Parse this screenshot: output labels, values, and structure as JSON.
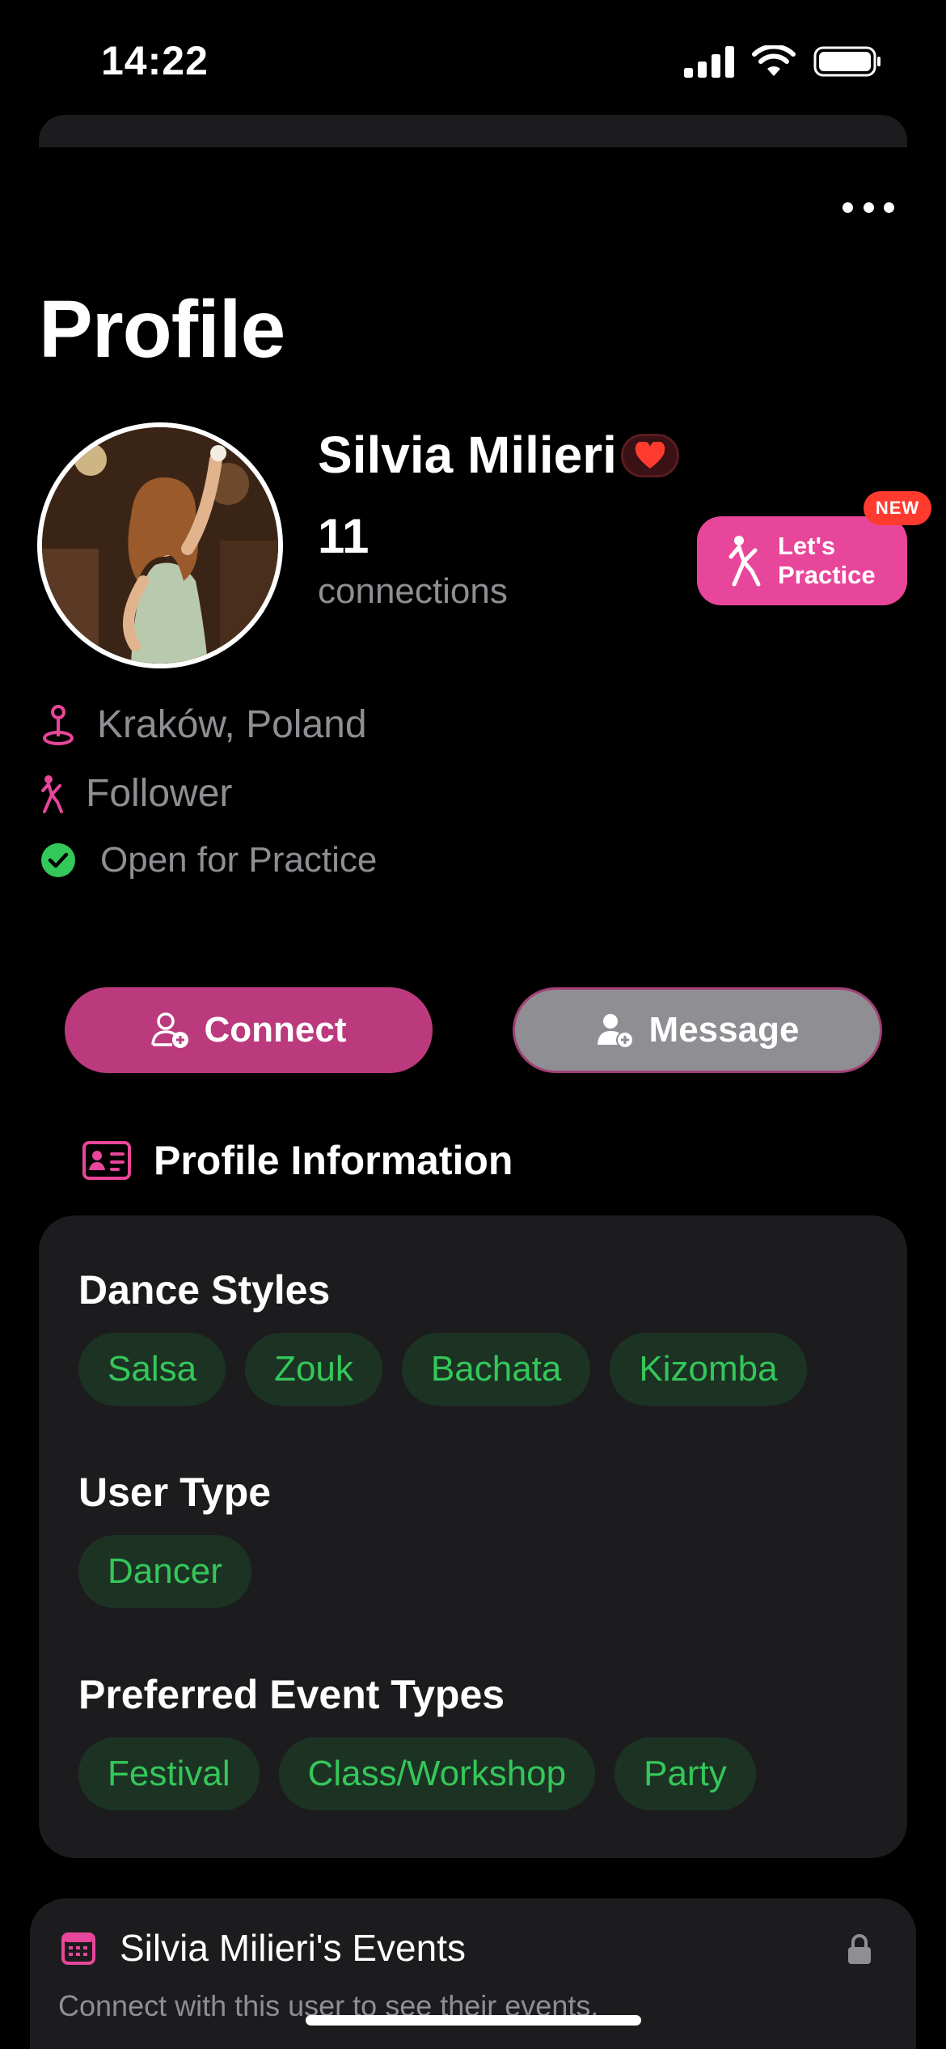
{
  "status_bar": {
    "time": "14:22",
    "icons": [
      "signal-icon",
      "wifi-icon",
      "battery-icon"
    ]
  },
  "header": {
    "title": "Profile",
    "more_icon": "more-horizontal-icon"
  },
  "profile": {
    "name": "Silvia Milieri",
    "connections_count": "11",
    "connections_label": "connections",
    "badge_icon": "heart-icon",
    "location": "Kraków, Poland",
    "role": "Follower",
    "availability": "Open for Practice"
  },
  "practice_button": {
    "label": "Let's\nPractice",
    "badge": "NEW"
  },
  "actions": {
    "connect_label": "Connect",
    "message_label": "Message"
  },
  "profile_information": {
    "title": "Profile Information",
    "groups": [
      {
        "label": "Dance Styles",
        "chips": [
          "Salsa",
          "Zouk",
          "Bachata",
          "Kizomba"
        ]
      },
      {
        "label": "User Type",
        "chips": [
          "Dancer"
        ]
      },
      {
        "label": "Preferred Event Types",
        "chips": [
          "Festival",
          "Class/Workshop",
          "Party"
        ]
      }
    ]
  },
  "events": {
    "title": "Silvia Milieri's Events",
    "subtitle": "Connect with this user to see their events."
  },
  "colors": {
    "accent_pink": "#e8469a",
    "connect_pink": "#bb3a7d",
    "chip_green": "#34c759",
    "chip_bg": "#1c3324",
    "card_bg": "#1c1c1e",
    "muted_text": "#8e8e93",
    "badge_red": "#ff3b30"
  }
}
